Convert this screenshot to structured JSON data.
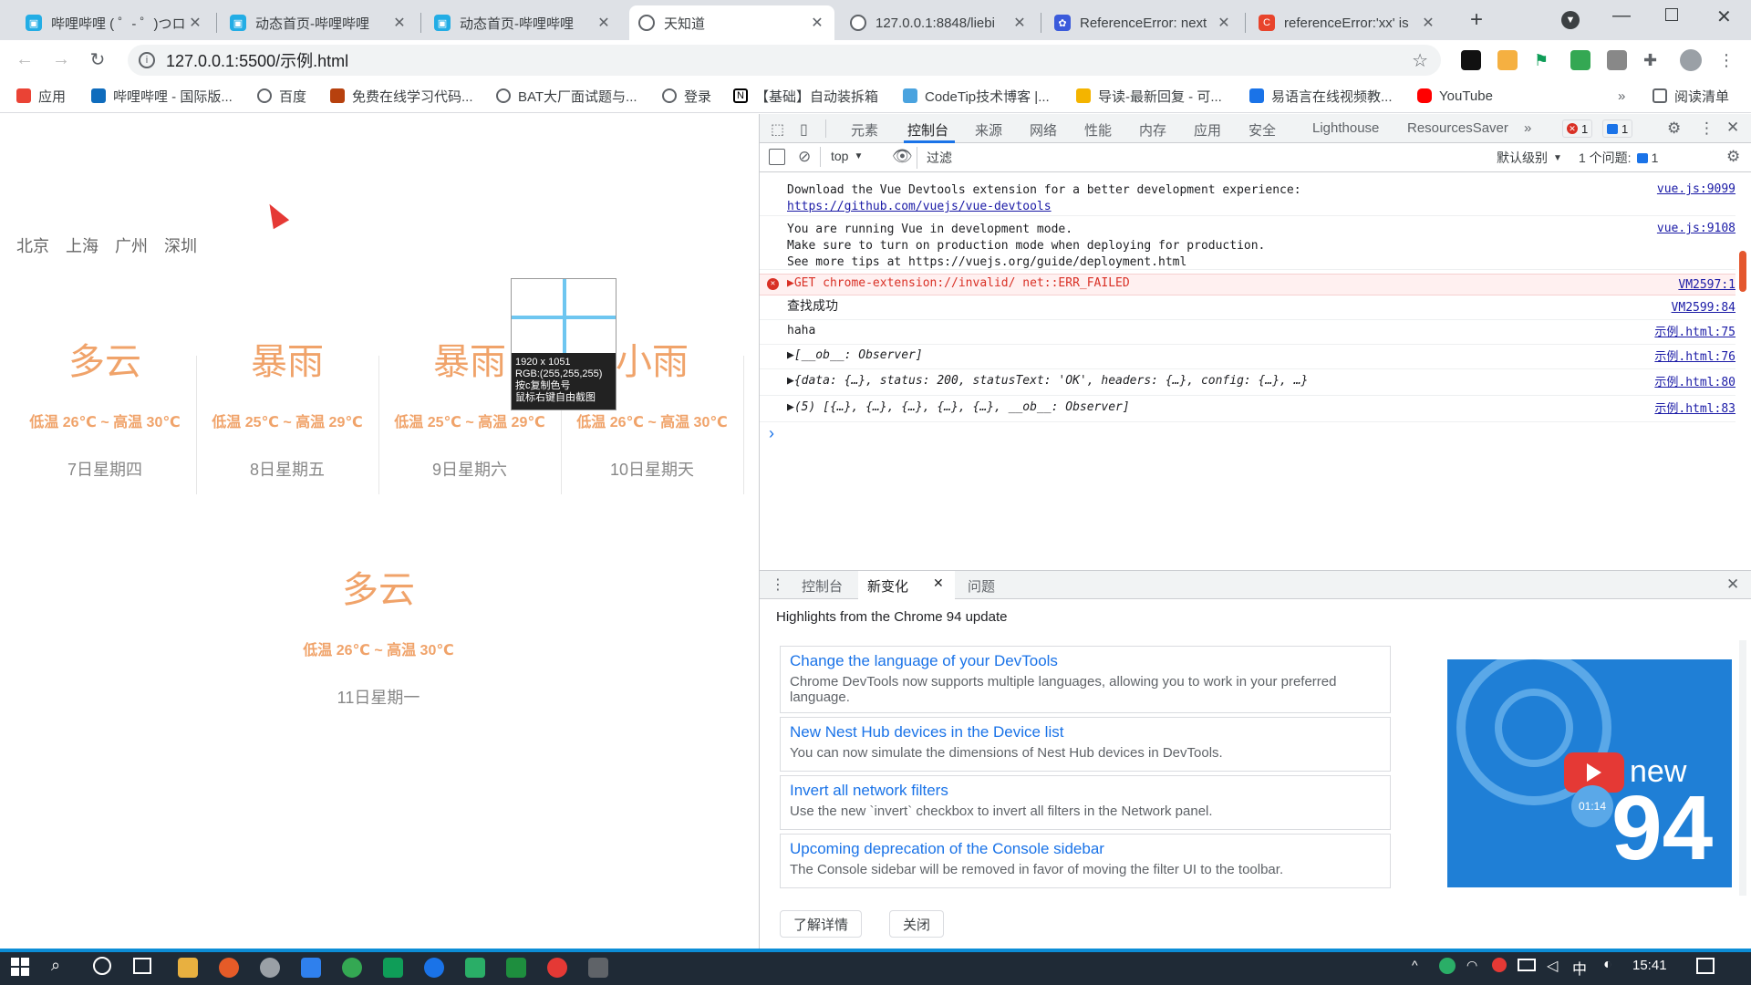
{
  "tabs": [
    {
      "title": "哔哩哔哩 ( ゜- ゜)つロ",
      "icon": "bilibili-icon",
      "color": "#23ade5"
    },
    {
      "title": "动态首页-哔哩哔哩",
      "icon": "bilibili-icon",
      "color": "#23ade5"
    },
    {
      "title": "动态首页-哔哩哔哩",
      "icon": "bilibili-icon",
      "color": "#23ade5"
    },
    {
      "title": "天知道",
      "icon": "globe-icon",
      "color": "#5f6368"
    },
    {
      "title": "127.0.0.1:8848/liebi",
      "icon": "globe-icon",
      "color": "#5f6368"
    },
    {
      "title": "ReferenceError: next",
      "icon": "paw-icon",
      "color": "#3b5bdb"
    },
    {
      "title": "referenceError:'xx' is",
      "icon": "csdn-icon",
      "color": "#e8442c"
    }
  ],
  "active_tab": 3,
  "address": "127.0.0.1:5500/示例.html",
  "bookmarks": [
    {
      "label": "应用",
      "icon": "apps-icon",
      "color": "#ea4335"
    },
    {
      "label": "哔哩哔哩 - 国际版...",
      "icon": "bing-icon",
      "color": "#0f6cbd"
    },
    {
      "label": "百度",
      "icon": "globe-icon",
      "color": "#5f6368"
    },
    {
      "label": "免费在线学习代码...",
      "icon": "code-icon",
      "color": "#b7410e"
    },
    {
      "label": "BAT大厂面试题与...",
      "icon": "globe-icon",
      "color": "#5f6368"
    },
    {
      "label": "登录",
      "icon": "globe-icon",
      "color": "#5f6368"
    },
    {
      "label": "【基础】自动装拆箱",
      "icon": "notion-icon",
      "color": "#000000"
    },
    {
      "label": "CodeTip技术博客 |...",
      "icon": "codetip-icon",
      "color": "#4aa3df"
    },
    {
      "label": "导读-最新回复 - 可...",
      "icon": "folder-icon",
      "color": "#f4b400"
    },
    {
      "label": "易语言在线视频教...",
      "icon": "tv-icon",
      "color": "#1a73e8"
    },
    {
      "label": "YouTube",
      "icon": "youtube-icon",
      "color": "#ff0000"
    }
  ],
  "reading_list": "阅读清单",
  "page": {
    "cities": [
      "北京",
      "上海",
      "广州",
      "深圳"
    ],
    "forecast": [
      {
        "condition": "多云",
        "temp": "低温 26℃ ~ 高温 30℃",
        "date": "7日星期四"
      },
      {
        "condition": "暴雨",
        "temp": "低温 25℃ ~ 高温 29℃",
        "date": "8日星期五"
      },
      {
        "condition": "暴雨",
        "temp": "低温 25℃ ~ 高温 29℃",
        "date": "9日星期六"
      },
      {
        "condition": "小雨",
        "temp": "低温 26℃ ~ 高温 30℃",
        "date": "10日星期天"
      },
      {
        "condition": "多云",
        "temp": "低温 26℃ ~ 高温 30℃",
        "date": "11日星期一"
      }
    ],
    "accent_color": "#f0a36a"
  },
  "magnifier": {
    "size": "1920 x 1051",
    "rgb": "RGB:(255,255,255)",
    "hint1": "按c复制色号",
    "hint2": "鼠标右键自由截图"
  },
  "devtools": {
    "tabs": [
      "元素",
      "控制台",
      "来源",
      "网络",
      "性能",
      "内存",
      "应用",
      "安全",
      "Lighthouse",
      "ResourcesSaver"
    ],
    "active_tab": "控制台",
    "error_count": "1",
    "message_count": "1",
    "context": "top",
    "filter_placeholder": "过滤",
    "level": "默认级别",
    "issues": "1 个问题:",
    "issues_count": "1",
    "console": [
      {
        "lines": [
          "Download the Vue Devtools extension for a better development experience:",
          "https://github.com/vuejs/vue-devtools"
        ],
        "src": "vue.js:9099",
        "type": "log"
      },
      {
        "lines": [
          "You are running Vue in development mode.",
          "Make sure to turn on production mode when deploying for production.",
          "See more tips at https://vuejs.org/guide/deployment.html"
        ],
        "src": "vue.js:9108",
        "type": "log"
      },
      {
        "lines": [
          "▶GET chrome-extension://invalid/ net::ERR_FAILED"
        ],
        "src": "VM2597:1",
        "type": "error"
      },
      {
        "lines": [
          "查找成功"
        ],
        "src": "VM2599:84",
        "type": "log"
      },
      {
        "lines": [
          "haha"
        ],
        "src": "示例.html:75",
        "type": "log"
      },
      {
        "lines": [
          "▶[__ob__: Observer]"
        ],
        "src": "示例.html:76",
        "type": "log"
      },
      {
        "lines": [
          "▶{data: {…}, status: 200, statusText: 'OK', headers: {…}, config: {…}, …}"
        ],
        "src": "示例.html:80",
        "type": "log"
      },
      {
        "lines": [
          "▶(5) [{…}, {…}, {…}, {…}, {…}, __ob__: Observer]"
        ],
        "src": "示例.html:83",
        "type": "log"
      }
    ],
    "prompt": "›",
    "drawer": {
      "tabs": [
        "控制台",
        "新变化",
        "问题"
      ],
      "active": "新变化",
      "headline": "Highlights from the Chrome 94 update",
      "cards": [
        {
          "title": "Change the language of your DevTools",
          "desc": "Chrome DevTools now supports multiple languages, allowing you to work in your preferred language."
        },
        {
          "title": "New Nest Hub devices in the Device list",
          "desc": "You can now simulate the dimensions of Nest Hub devices in DevTools."
        },
        {
          "title": "Invert all network filters",
          "desc": "Use the new `invert` checkbox to invert all filters in the Network panel."
        },
        {
          "title": "Upcoming deprecation of the Console sidebar",
          "desc": "The Console sidebar will be removed in favor of moving the filter UI to the toolbar."
        }
      ],
      "video_label_new": "new",
      "video_label_num": "94",
      "video_time": "01:14",
      "learn_more": "了解详情",
      "close": "关闭"
    }
  },
  "taskbar": {
    "time": "15:41",
    "ime": "中"
  }
}
